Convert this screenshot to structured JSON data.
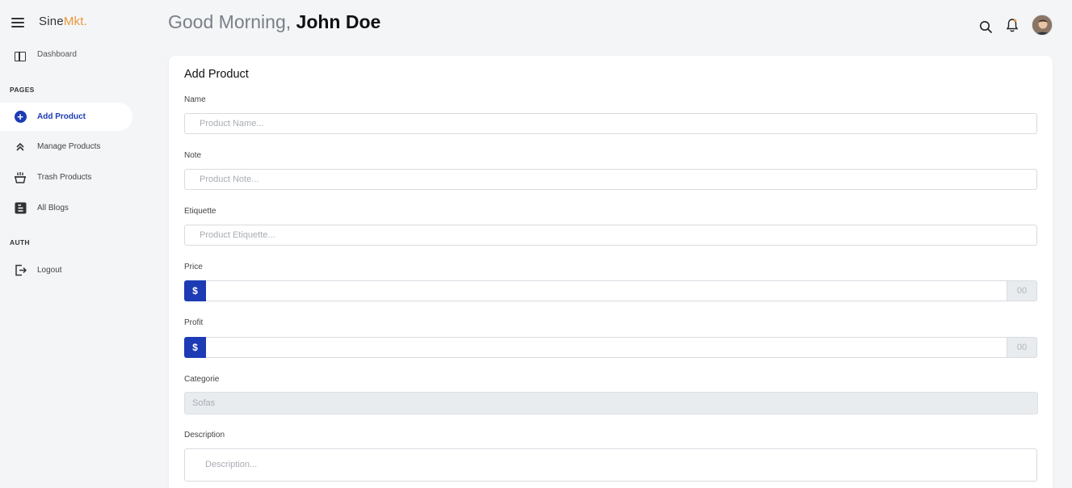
{
  "brand": {
    "part1": "Sine",
    "part2": "Mkt."
  },
  "header": {
    "greeting": "Good Morning, ",
    "user_name": "John Doe"
  },
  "sidebar": {
    "clipped_item": "Dashboard",
    "sections": {
      "pages": "PAGES",
      "auth": "AUTH"
    },
    "items": [
      {
        "label": "Add Product",
        "icon": "plus-circle-icon",
        "active": true
      },
      {
        "label": "Manage Products",
        "icon": "chevrons-up-icon",
        "active": false
      },
      {
        "label": "Trash Products",
        "icon": "trash-basket-icon",
        "active": false
      },
      {
        "label": "All Blogs",
        "icon": "blogger-icon",
        "active": false
      },
      {
        "label": "Logout",
        "icon": "logout-icon",
        "active": false
      }
    ]
  },
  "form": {
    "title": "Add Product",
    "name": {
      "label": "Name",
      "placeholder": "Product Name..."
    },
    "note": {
      "label": "Note",
      "placeholder": "Product Note..."
    },
    "etiquette": {
      "label": "Etiquette",
      "placeholder": "Product Etiquette..."
    },
    "price": {
      "label": "Price",
      "currency": "$",
      "decimals": "00"
    },
    "profit": {
      "label": "Profit",
      "currency": "$",
      "decimals": "00"
    },
    "categorie": {
      "label": "Categorie",
      "selected": "Sofas"
    },
    "description": {
      "label": "Description",
      "placeholder": "Description..."
    }
  },
  "colors": {
    "primary": "#1d3bb5",
    "brand_accent": "#e8963a",
    "background": "#f4f5f7"
  }
}
